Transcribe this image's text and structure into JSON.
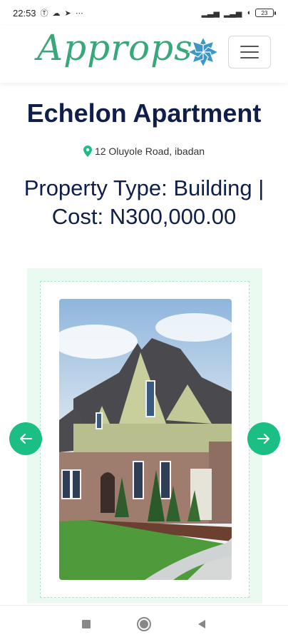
{
  "status_bar": {
    "time": "22:53",
    "battery": "23"
  },
  "header": {
    "logo_text": "Approps",
    "brand_color": "#37a878",
    "icons": [
      "logo-flower-icon",
      "hamburger-menu-icon"
    ]
  },
  "property": {
    "name": "Echelon Apartment",
    "address": "12 Oluyole Road, ibadan",
    "info": "Property Type: Building | Cost: N300,000.00"
  },
  "carousel": {
    "accent_color": "#1bbf84",
    "background_color": "#eafaf1",
    "prev_icon": "arrow-left-icon",
    "next_icon": "arrow-right-icon"
  },
  "system_nav": {
    "icons": [
      "recents-square-icon",
      "home-circle-icon",
      "back-triangle-icon"
    ]
  }
}
